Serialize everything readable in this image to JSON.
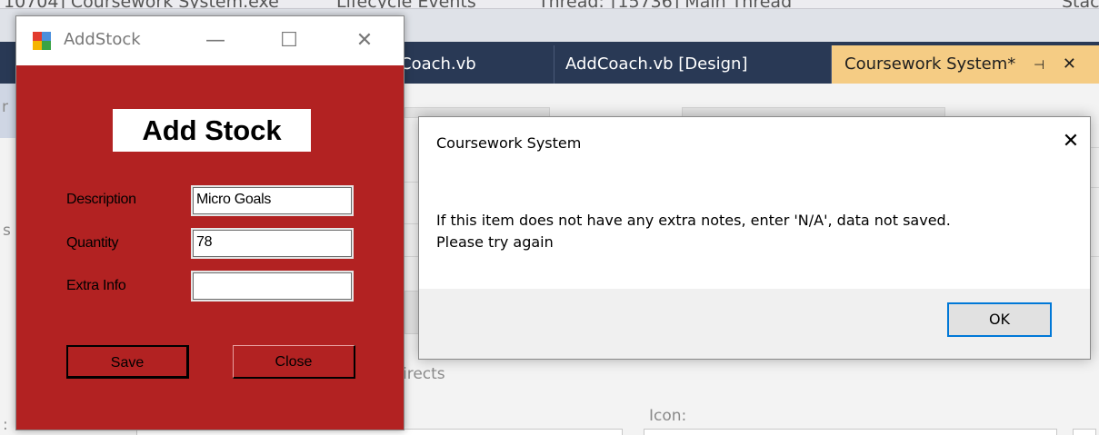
{
  "ide": {
    "topbar": {
      "process_text": "10704] Coursework System.exe",
      "lifecycle_text": "Lifecycle Events",
      "thread_label": "Thread:",
      "thread_value": "[15736] Main Thread",
      "stack_text": "Stac"
    },
    "tabs": [
      {
        "label": "Coach.vb"
      },
      {
        "label": "AddCoach.vb [Design]"
      },
      {
        "label": "Coursework System*",
        "active": true
      }
    ],
    "workarea": {
      "left_letter_top": "r",
      "left_letter_mid": "s",
      "redirects_text": "irects",
      "icon_label": "Icon:",
      "bottom_mark": ":"
    }
  },
  "addstock": {
    "window_title": "AddStock",
    "heading": "Add Stock",
    "fields": {
      "description": {
        "label": "Description",
        "value": "Micro Goals"
      },
      "quantity": {
        "label": "Quantity",
        "value": "78"
      },
      "extra_info": {
        "label": "Extra Info",
        "value": ""
      }
    },
    "save_label": "Save",
    "close_label": "Close",
    "window_controls": {
      "minimize": "—",
      "maximize": "☐",
      "close": "✕"
    }
  },
  "messagebox": {
    "title": "Coursework System",
    "message_line1": "If this item does not have any extra notes, enter 'N/A', data not saved.",
    "message_line2": "Please try again",
    "ok_label": "OK",
    "close_glyph": "✕"
  },
  "colors": {
    "form_background": "#b22222",
    "ide_tab_strip": "#293955",
    "active_tab": "#f5cc84",
    "ok_focus_border": "#0078d7"
  }
}
